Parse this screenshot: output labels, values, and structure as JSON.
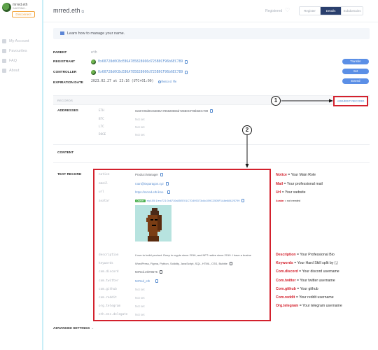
{
  "sidebar": {
    "account_name": "mrred.eth",
    "account_sub": "0x60728d0...",
    "disconnect_label": "Disconnect",
    "nav": [
      {
        "label": "My Account",
        "icon": "user-icon"
      },
      {
        "label": "Favourites",
        "icon": "heart-icon"
      },
      {
        "label": "FAQ",
        "icon": "question-icon"
      },
      {
        "label": "About",
        "icon": "info-icon"
      }
    ]
  },
  "header": {
    "name": "mrred.eth",
    "ext_glyph": "⧉",
    "status": "Registered",
    "tabs": [
      "Register",
      "Details",
      "Subdomains"
    ],
    "active_tab": "Details"
  },
  "learn": {
    "text": "Learn how to manage your name."
  },
  "info": {
    "parent_label": "PARENT",
    "parent_value": "eth",
    "registrant_label": "REGISTRANT",
    "registrant_value": "0x60728d0C8cE86A785828666d725B0CF96b6EC789",
    "controller_label": "CONTROLLER",
    "controller_value": "0x60728d0C8cE86A785828666d725B0CF96b6EC789",
    "expiration_label": "EXPIRATION DATE",
    "expiration_value": "2023.02.27 at 23:16 (UTC+01:00)",
    "remind_label": "Remind Me",
    "transfer_label": "Transfer",
    "set_label": "Set",
    "extend_label": "Extend"
  },
  "records": {
    "header": "RECORDS",
    "add_edit_label": "ADD/EDIT RECORD",
    "addresses_label": "ADDRESSES",
    "addresses": [
      {
        "key": "ETH",
        "value": "0x60728d0C8cE86A785828666d725B0CF96b6EC789"
      },
      {
        "key": "BTC",
        "value": "Not set"
      },
      {
        "key": "LTC",
        "value": "Not set"
      },
      {
        "key": "DOGE",
        "value": "Not set"
      }
    ],
    "content_label": "CONTENT",
    "text_record_label": "TEXT RECORD",
    "text_records": [
      {
        "key": "notice",
        "value": "Product Manager"
      },
      {
        "key": "email",
        "value": "ruan@0xparagon.xyz"
      },
      {
        "key": "url",
        "value": "https://mrred.eth.limo"
      },
      {
        "key": "avatar",
        "owner": "Owner",
        "value": "eip155:1/erc721:0x6710a55EE01C7D495373c8c1B9C2505F1A6e6842/5799"
      },
      {
        "key": "description",
        "value": "I love to build product. Deep in crypto since 2016, and NFT native since 2019. I have a busine"
      },
      {
        "key": "keywords",
        "value": "WordPress, Figma, Python, Solidity, JavaScript, SQL, HTML, CSS, Bubble"
      },
      {
        "key": "com.discord",
        "value": "MrRed.eth#8576"
      },
      {
        "key": "com.twitter",
        "value": "MrRed_eth"
      },
      {
        "key": "com.github",
        "value": "Not set"
      },
      {
        "key": "com.reddit",
        "value": "Not set"
      },
      {
        "key": "org.telegram",
        "value": "Not set"
      },
      {
        "key": "eth.ens.delegate",
        "value": "Not set"
      }
    ]
  },
  "annotations": {
    "circle1": "1",
    "circle2": "2",
    "items": [
      {
        "key": "Notice",
        "text": " = Your Main Role"
      },
      {
        "key": "Mail",
        "text": " = Your professional mail"
      },
      {
        "key": "Url",
        "text": " = Your website"
      },
      {
        "key": "Avatar",
        "text": " = not needed"
      },
      {
        "key": "Description",
        "text": " = Your Professional Bio"
      },
      {
        "key": "Keywords",
        "text": " = Your Hard Skill split by (,)"
      },
      {
        "key": "Com.discord",
        "text": " = Your discord username"
      },
      {
        "key": "Com.twitter",
        "text": " = Your twitter username"
      },
      {
        "key": "Com.github",
        "text": " = Your github"
      },
      {
        "key": "Com.reddit",
        "text": " = Your reddit username"
      },
      {
        "key": "Org.telegram",
        "text": " = Your telegram username"
      }
    ]
  },
  "advanced": {
    "label": "ADVANCED SETTINGS",
    "chevron": "⌄"
  },
  "colors": {
    "accent": "#5b8fe6",
    "annotation_red": "#d3212d",
    "sidebar_border": "#c9eef7"
  }
}
